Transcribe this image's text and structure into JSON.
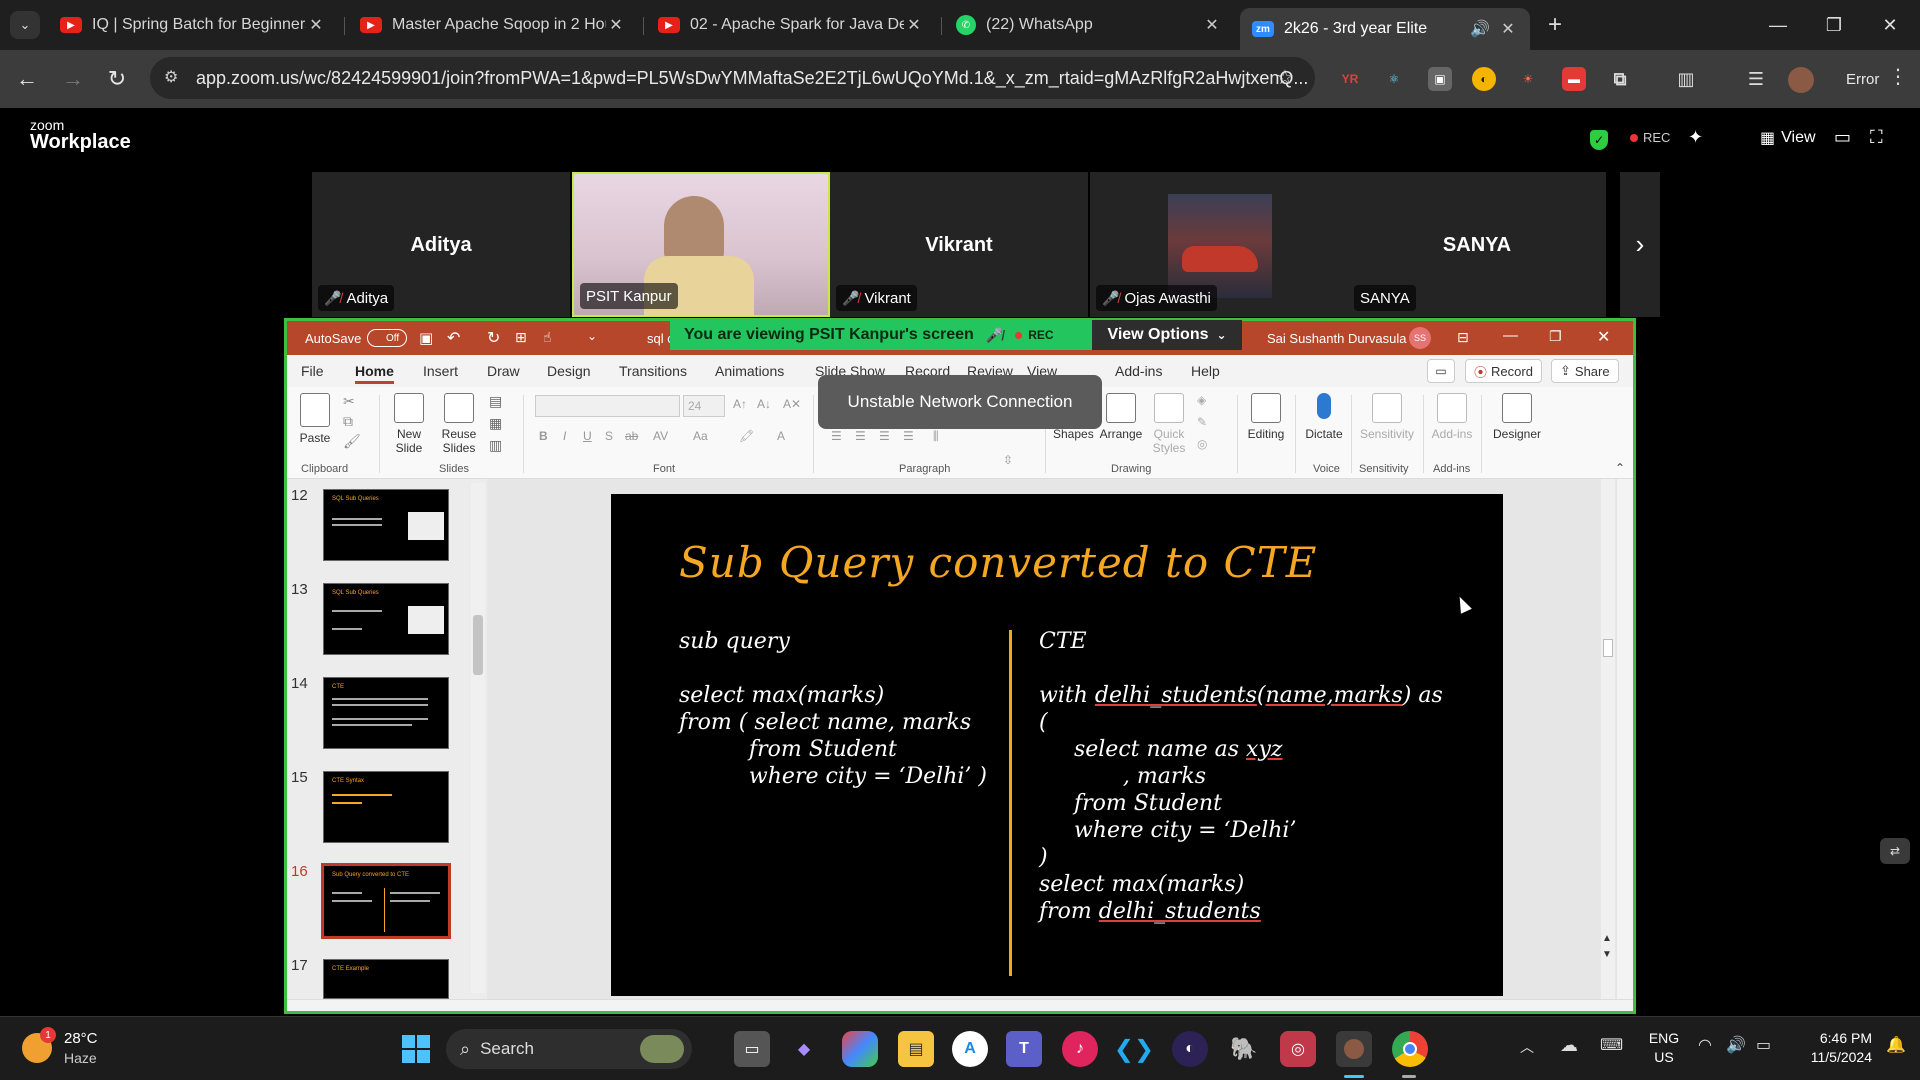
{
  "browser": {
    "tabs": [
      {
        "title": "IQ | Spring Batch for Beginners",
        "icon": "youtube-icon"
      },
      {
        "title": "Master Apache Sqoop in 2 Hou",
        "icon": "youtube-icon"
      },
      {
        "title": "02 - Apache Spark for Java Dev",
        "icon": "youtube-icon"
      },
      {
        "title": "(22) WhatsApp",
        "icon": "whatsapp-icon"
      },
      {
        "title": "2k26 - 3rd year Elite",
        "icon": "zoom-icon"
      }
    ],
    "url": "app.zoom.us/wc/82424599901/join?fromPWA=1&pwd=PL5WsDwYMMaftaSe2E2TjL6wUQoYMd.1&_x_zm_rtaid=gMAzRlfgR2aHwjtxenQ...",
    "profile_status": "Error"
  },
  "zoom": {
    "brand_small": "zoom",
    "brand_large": "Workplace",
    "rec_label": "REC",
    "view_label": "View",
    "participants": [
      {
        "big_name": "Aditya",
        "tag": "Aditya",
        "muted": true
      },
      {
        "big_name": "",
        "tag": "PSIT Kanpur",
        "muted": false
      },
      {
        "big_name": "Vikrant",
        "tag": "Vikrant",
        "muted": true
      },
      {
        "big_name": "",
        "tag": "Ojas Awasthi",
        "muted": true
      },
      {
        "big_name": "SANYA",
        "tag": "SANYA",
        "muted": false
      }
    ],
    "viewing_banner": "You are viewing  PSIT Kanpur's screen",
    "banner_rec": "REC",
    "view_options": "View Options",
    "toast": "Unstable Network Connection"
  },
  "powerpoint": {
    "autosave": "AutoSave",
    "autosave_state": "Off",
    "file_fragment": "sql c",
    "user": "Sai Sushanth Durvasula",
    "user_initials": "SS",
    "tabs": [
      "File",
      "Home",
      "Insert",
      "Draw",
      "Design",
      "Transitions",
      "Animations",
      "Slide Show",
      "Record",
      "Review",
      "View",
      "Add-ins",
      "Help"
    ],
    "record_btn": "Record",
    "share_btn": "Share",
    "ribbon": {
      "paste": "Paste",
      "new_slide": "New Slide",
      "reuse_slides": "Reuse Slides",
      "font_size": "24",
      "shapes": "Shapes",
      "arrange": "Arrange",
      "quick_styles": "Quick Styles",
      "editing": "Editing",
      "dictate": "Dictate",
      "sensitivity": "Sensitivity",
      "addins": "Add-ins",
      "designer": "Designer",
      "groups": [
        "Clipboard",
        "Slides",
        "Font",
        "Paragraph",
        "Drawing",
        "Voice",
        "Sensitivity",
        "Add-ins"
      ]
    },
    "thumbnails": [
      {
        "num": "12",
        "title": "SQL Sub Queries"
      },
      {
        "num": "13",
        "title": "SQL Sub Queries"
      },
      {
        "num": "14",
        "title": "CTE"
      },
      {
        "num": "15",
        "title": "CTE Syntax"
      },
      {
        "num": "16",
        "title": "Sub Query converted to CTE"
      },
      {
        "num": "17",
        "title": "CTE Example"
      }
    ],
    "slide": {
      "title": "Sub Query converted to CTE",
      "left_heading": "sub query",
      "left_l1": "select max(marks)",
      "left_l2": "from ( select name, marks",
      "left_l3": "          from Student",
      "left_l4": "          where city = ‘Delhi’ )",
      "right_heading": "CTE",
      "right_l1_a": "with ",
      "right_l1_b": "delhi_students",
      "right_l1_c": "(",
      "right_l1_d": "name,marks",
      "right_l1_e": ") as",
      "right_l2": "(",
      "right_l3_a": "     select name as ",
      "right_l3_b": "xyz",
      "right_l4": "            , marks",
      "right_l5": "     from Student",
      "right_l6": "     where city = ‘Delhi’",
      "right_l7": ")",
      "right_l8": "select max(marks)",
      "right_l9_a": "from ",
      "right_l9_b": "delhi_students"
    }
  },
  "taskbar": {
    "weather_temp": "28°C",
    "weather_desc": "Haze",
    "weather_badge": "1",
    "search": "Search",
    "lang": "ENG",
    "region": "US",
    "time": "6:46 PM",
    "date": "11/5/2024"
  }
}
